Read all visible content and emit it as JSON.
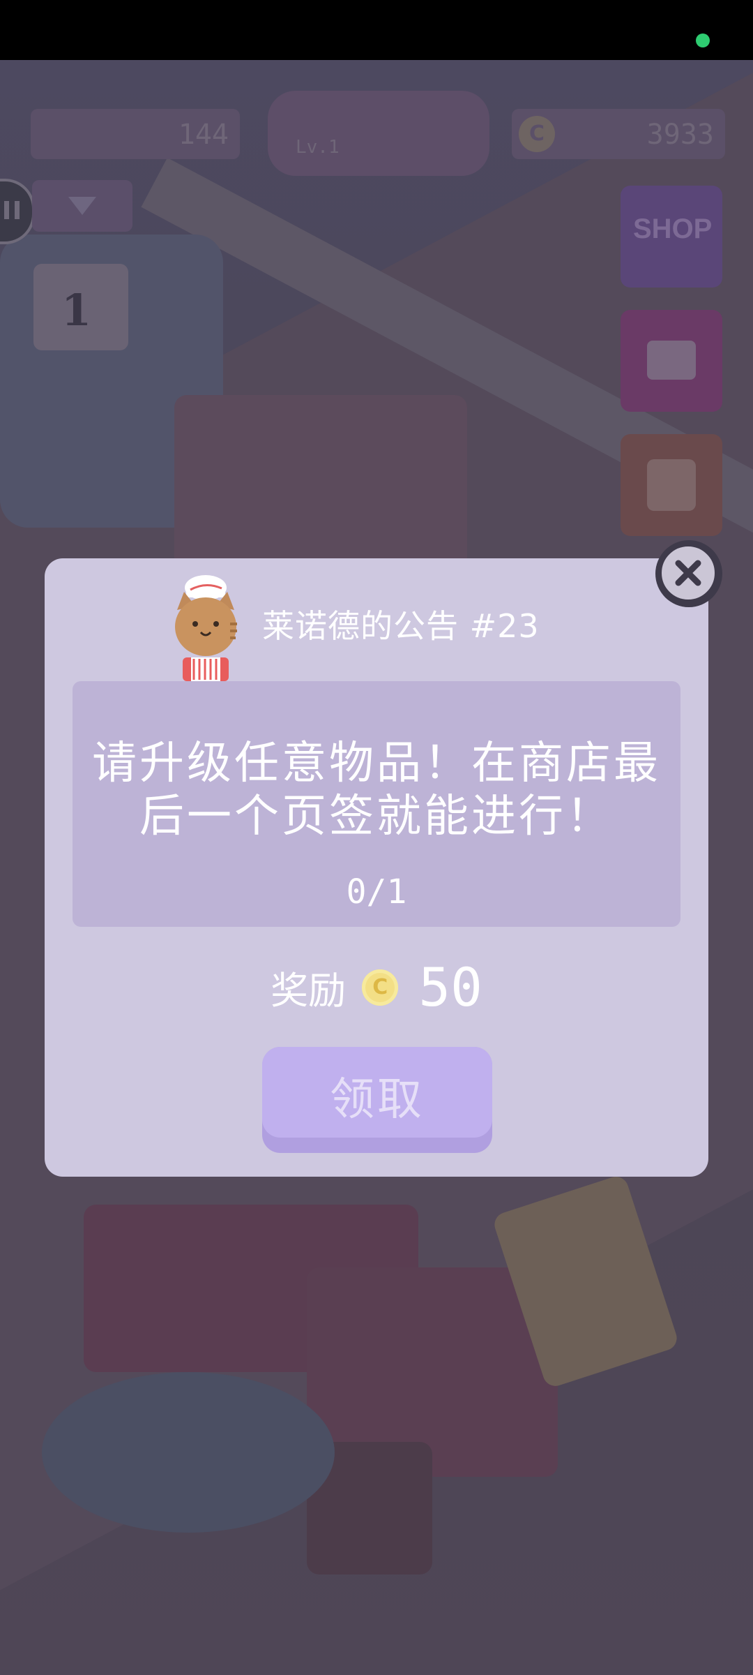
{
  "hud": {
    "resource_count": "144",
    "center_banner": "Lv.1",
    "coin_balance": "3933",
    "shop_label": "SHOP",
    "calendar_day": "1"
  },
  "dialog": {
    "title": "莱诺德的公告 #23",
    "task_text": "请升级任意物品！在商店最后一个页签就能进行！",
    "progress": "0/1",
    "reward_label": "奖励",
    "reward_amount": "50",
    "coin_symbol": "C",
    "claim_label": "领取"
  },
  "colors": {
    "dialog_bg": "#cec8e0",
    "task_box_bg": "#bdb3d6",
    "claim_button": "#c0b0ee",
    "coin": "#f3df86",
    "status_dot": "#2ecc71"
  },
  "icons": {
    "close": "close-icon",
    "coin": "coin-icon",
    "pause": "pause-icon",
    "dropdown": "chevron-down-icon",
    "shop": "shop-cart-icon",
    "chest": "treasure-chest-icon",
    "shirt": "shirt-icon",
    "mascot": "cat-chef-icon"
  }
}
